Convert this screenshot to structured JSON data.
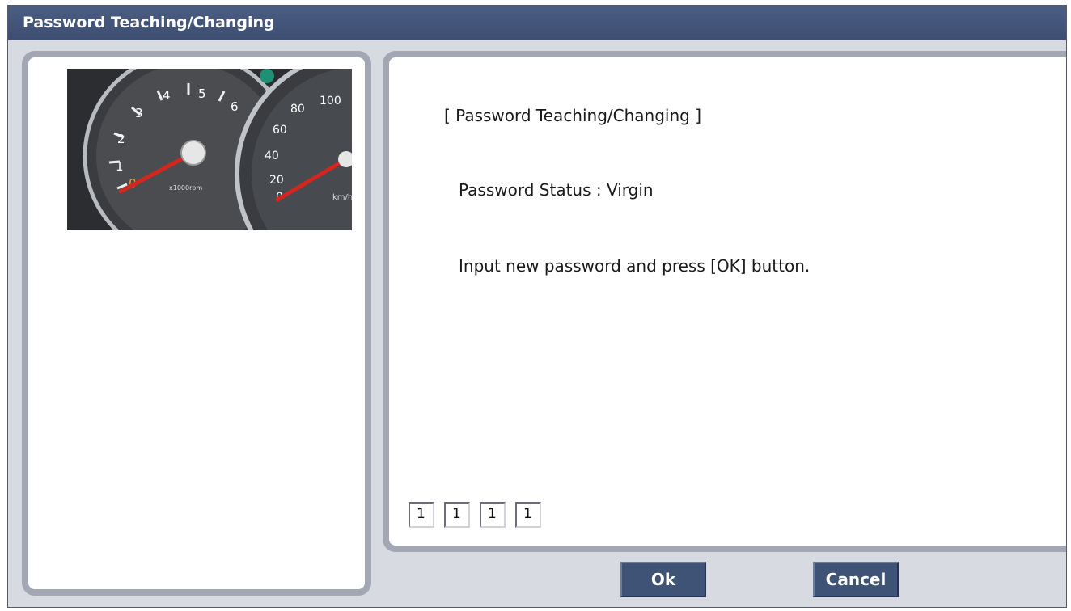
{
  "window": {
    "title": "Password Teaching/Changing"
  },
  "content": {
    "heading": "[ Password Teaching/Changing ]",
    "status_label": "Password Status",
    "status_separator": " : ",
    "status_value": "Virgin",
    "instruction": "Input new password and press [OK] button."
  },
  "password_digits": [
    "1",
    "1",
    "1",
    "1"
  ],
  "cluster_image": {
    "tach_labels": [
      "0",
      "1",
      "2",
      "3",
      "4",
      "5",
      "6"
    ],
    "tach_unit": "x1000rpm",
    "speed_labels": [
      "0",
      "20",
      "40",
      "60",
      "80",
      "100"
    ],
    "speed_unit": "km/h"
  },
  "buttons": {
    "ok_label": "Ok",
    "cancel_label": "Cancel"
  },
  "colors": {
    "titlebar": "#42547a",
    "panel_border": "#a3a7b4",
    "button": "#3f5377",
    "needle": "#d2261f"
  }
}
